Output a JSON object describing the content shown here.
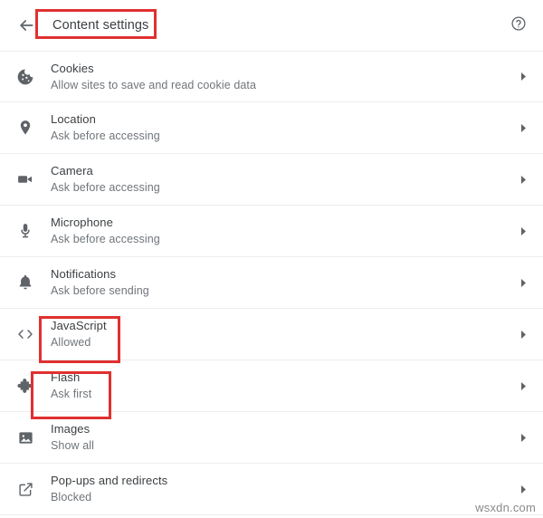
{
  "header": {
    "back_icon": "back-arrow-icon",
    "title": "Content settings",
    "help_icon": "help-circle-icon"
  },
  "colors": {
    "annotation_red": "#e03030",
    "title_text": "#3c4043",
    "subtitle_text": "#70757a",
    "icon_gray": "#5f6368",
    "divider": "#ededed",
    "background": "#ffffff"
  },
  "settings": [
    {
      "icon": "cookie-icon",
      "title": "Cookies",
      "subtitle": "Allow sites to save and read cookie data",
      "chevron": "chevron-right-icon",
      "highlighted": false
    },
    {
      "icon": "location-pin-icon",
      "title": "Location",
      "subtitle": "Ask before accessing",
      "chevron": "chevron-right-icon",
      "highlighted": false
    },
    {
      "icon": "video-camera-icon",
      "title": "Camera",
      "subtitle": "Ask before accessing",
      "chevron": "chevron-right-icon",
      "highlighted": false
    },
    {
      "icon": "microphone-icon",
      "title": "Microphone",
      "subtitle": "Ask before accessing",
      "chevron": "chevron-right-icon",
      "highlighted": false
    },
    {
      "icon": "bell-icon",
      "title": "Notifications",
      "subtitle": "Ask before sending",
      "chevron": "chevron-right-icon",
      "highlighted": false
    },
    {
      "icon": "code-brackets-icon",
      "title": "JavaScript",
      "subtitle": "Allowed",
      "chevron": "chevron-right-icon",
      "highlighted": true
    },
    {
      "icon": "puzzle-piece-icon",
      "title": "Flash",
      "subtitle": "Ask first",
      "chevron": "chevron-right-icon",
      "highlighted": true
    },
    {
      "icon": "image-icon",
      "title": "Images",
      "subtitle": "Show all",
      "chevron": "chevron-right-icon",
      "highlighted": false
    },
    {
      "icon": "external-link-icon",
      "title": "Pop-ups and redirects",
      "subtitle": "Blocked",
      "chevron": "chevron-right-icon",
      "highlighted": false
    }
  ],
  "watermark": "wsxdn.com"
}
